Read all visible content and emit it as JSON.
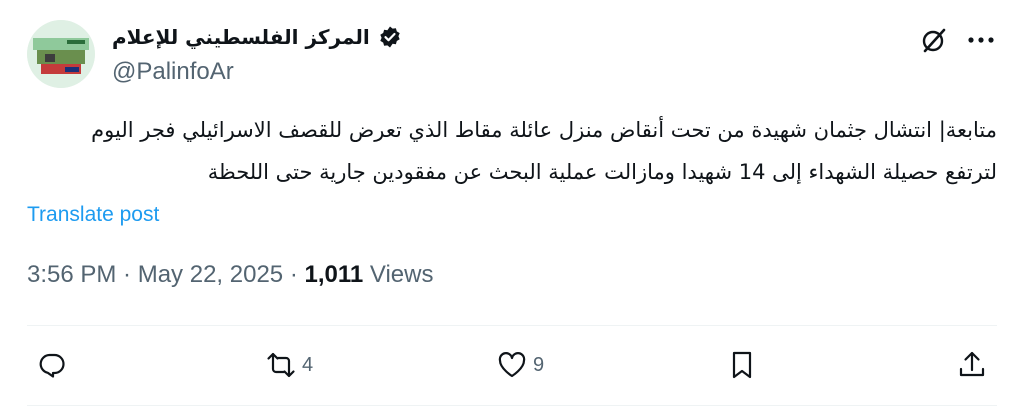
{
  "author": {
    "display_name": "المركز الفلسطيني للإعلام",
    "handle": "@PalinfoAr"
  },
  "tweet": {
    "text_line1": "متابعة| انتشال جثمان شهيدة من تحت أنقاض منزل عائلة مقاط الذي تعرض للقصف الاسرائيلي فجر اليوم",
    "text_line2": "لترتفع حصيلة الشهداء إلى 14 شهيدا ومازالت عملية البحث عن مفقودين جارية حتى اللحظة",
    "translate_label": "Translate post",
    "time": "3:56 PM",
    "date": "May 22, 2025",
    "views_count": "1,011",
    "views_label": "Views"
  },
  "actions": {
    "reply_icon": "reply-icon",
    "repost_count": "4",
    "like_count": "9",
    "bookmark_icon": "bookmark-icon",
    "share_icon": "share-icon"
  },
  "colors": {
    "text": "#0f1419",
    "secondary": "#536471",
    "link": "#1d9bf0"
  }
}
